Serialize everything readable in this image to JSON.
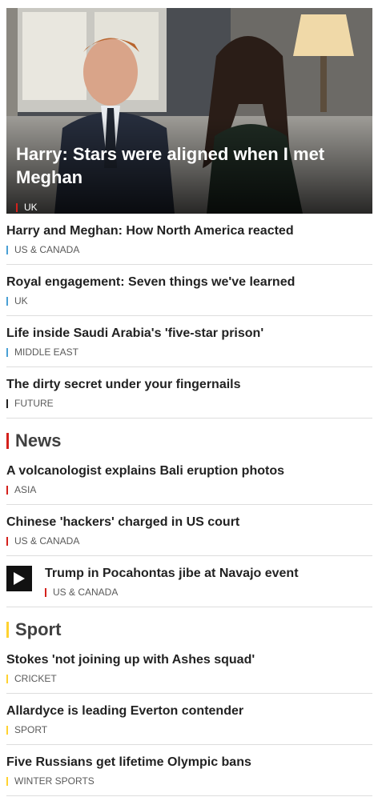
{
  "hero": {
    "title": "Harry: Stars were aligned when I met Meghan",
    "tag": "UK",
    "tag_color": "#d4211c"
  },
  "top_stories": [
    {
      "title": "Harry and Meghan: How North America reacted",
      "tag": "US & CANADA",
      "tag_color": "#4aa0d5"
    },
    {
      "title": "Royal engagement: Seven things we've learned",
      "tag": "UK",
      "tag_color": "#4aa0d5"
    },
    {
      "title": "Life inside Saudi Arabia's 'five-star prison'",
      "tag": "MIDDLE EAST",
      "tag_color": "#4aa0d5"
    },
    {
      "title": "The dirty secret under your fingernails",
      "tag": "FUTURE",
      "tag_color": "#222222"
    }
  ],
  "news": {
    "heading": "News",
    "accent": "#d4211c",
    "stories": [
      {
        "title": "A volcanologist explains Bali eruption photos",
        "tag": "ASIA"
      },
      {
        "title": "Chinese 'hackers' charged in US court",
        "tag": "US & CANADA"
      },
      {
        "title": "Trump in Pocahontas jibe at Navajo event",
        "tag": "US & CANADA",
        "video": true,
        "icon": "play-icon"
      }
    ]
  },
  "sport": {
    "heading": "Sport",
    "accent": "#ffd230",
    "stories": [
      {
        "title": "Stokes 'not joining up with Ashes squad'",
        "tag": "CRICKET"
      },
      {
        "title": "Allardyce is leading Everton contender",
        "tag": "SPORT"
      },
      {
        "title": "Five Russians get lifetime Olympic bans",
        "tag": "WINTER SPORTS"
      }
    ]
  }
}
